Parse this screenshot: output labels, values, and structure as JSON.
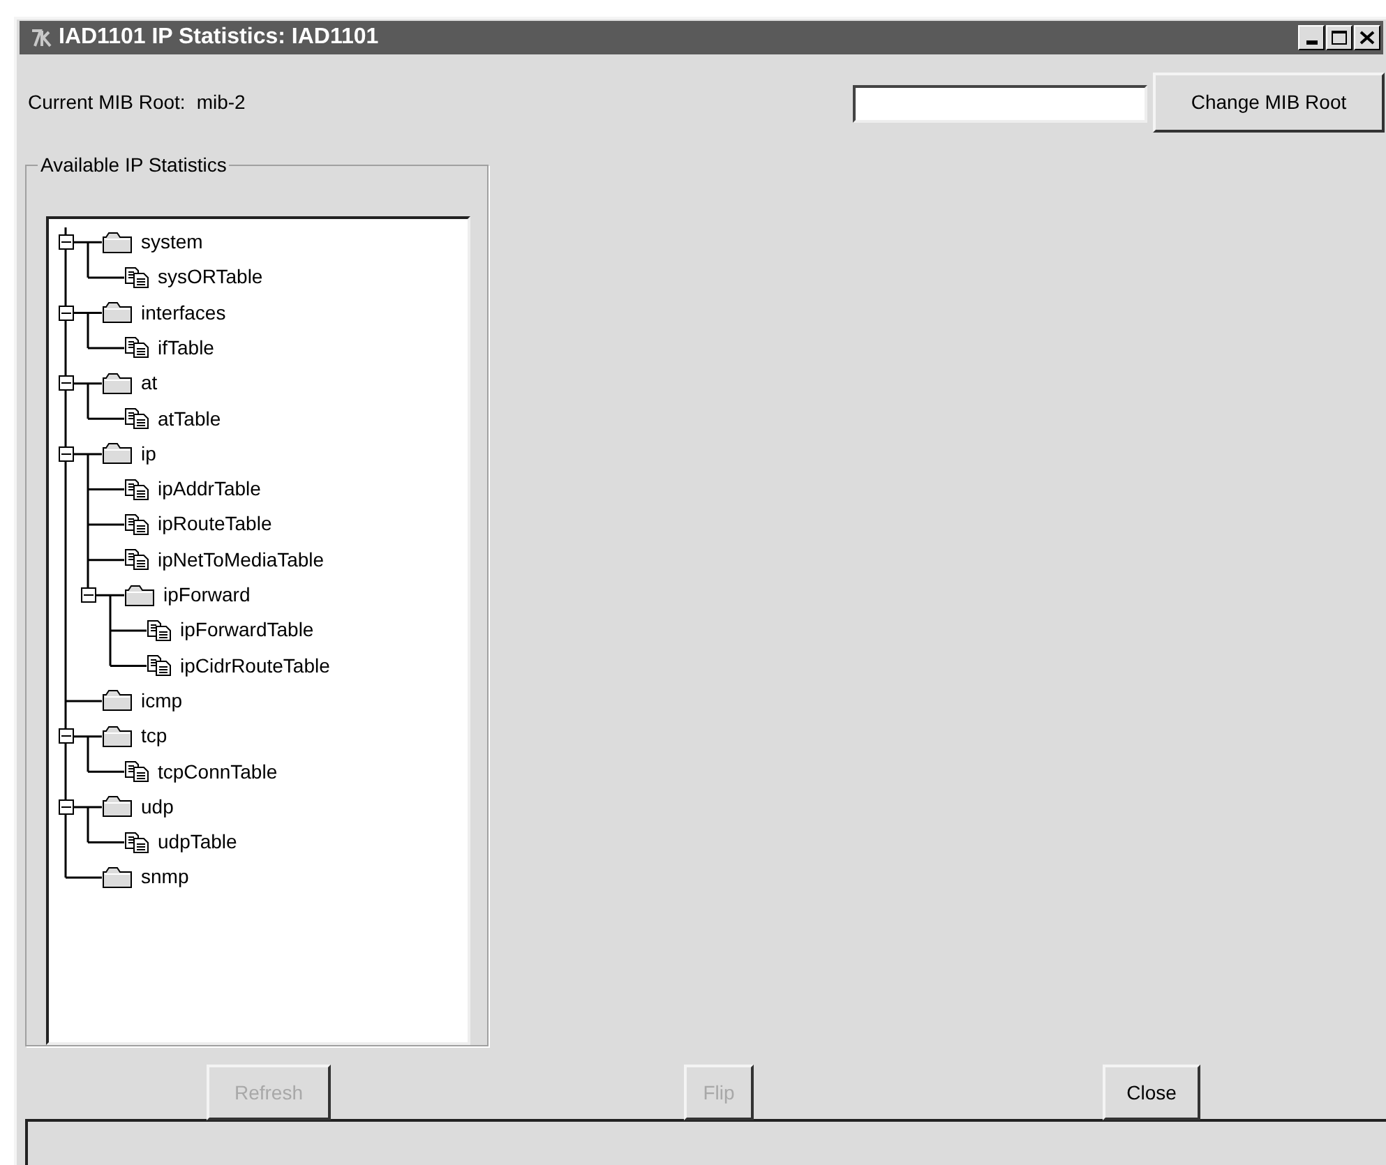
{
  "window": {
    "title": "IAD1101 IP Statistics:  IAD1101"
  },
  "mib_root": {
    "label": "Current MIB Root:",
    "value": "mib-2"
  },
  "change_root_button": "Change MIB Root",
  "group": {
    "legend": "Available IP Statistics"
  },
  "tree": [
    {
      "label": "system",
      "kind": "folder",
      "expanded": true,
      "children": [
        {
          "label": "sysORTable",
          "kind": "table"
        }
      ]
    },
    {
      "label": "interfaces",
      "kind": "folder",
      "expanded": true,
      "children": [
        {
          "label": "ifTable",
          "kind": "table"
        }
      ]
    },
    {
      "label": "at",
      "kind": "folder",
      "expanded": true,
      "children": [
        {
          "label": "atTable",
          "kind": "table"
        }
      ]
    },
    {
      "label": "ip",
      "kind": "folder",
      "expanded": true,
      "children": [
        {
          "label": "ipAddrTable",
          "kind": "table"
        },
        {
          "label": "ipRouteTable",
          "kind": "table"
        },
        {
          "label": "ipNetToMediaTable",
          "kind": "table"
        },
        {
          "label": "ipForward",
          "kind": "folder",
          "expanded": true,
          "children": [
            {
              "label": "ipForwardTable",
              "kind": "table"
            },
            {
              "label": "ipCidrRouteTable",
              "kind": "table"
            }
          ]
        }
      ]
    },
    {
      "label": "icmp",
      "kind": "folder"
    },
    {
      "label": "tcp",
      "kind": "folder",
      "expanded": true,
      "children": [
        {
          "label": "tcpConnTable",
          "kind": "table"
        }
      ]
    },
    {
      "label": "udp",
      "kind": "folder",
      "expanded": true,
      "children": [
        {
          "label": "udpTable",
          "kind": "table"
        }
      ]
    },
    {
      "label": "snmp",
      "kind": "folder"
    }
  ],
  "buttons": [
    {
      "label": "Refresh",
      "disabled": true
    },
    {
      "label": "Flip",
      "disabled": true
    },
    {
      "label": "Close",
      "disabled": false
    }
  ]
}
